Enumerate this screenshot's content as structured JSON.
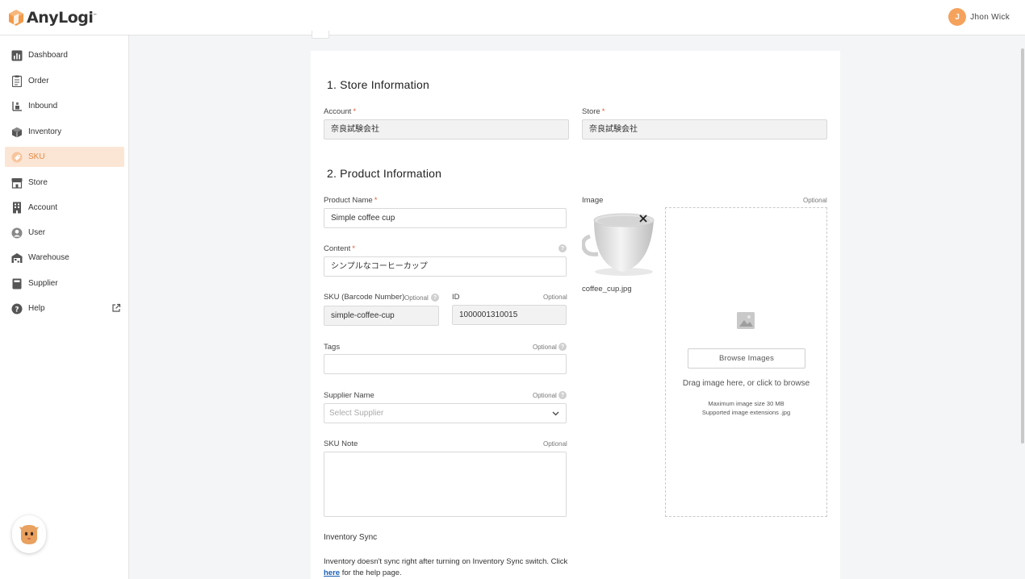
{
  "header": {
    "logo_text": "AnyLogi",
    "logo_tm": "™",
    "user_initial": "J",
    "user_name": "Jhon Wick"
  },
  "sidebar": {
    "items": [
      {
        "label": "Dashboard",
        "icon": "bar-chart-icon"
      },
      {
        "label": "Order",
        "icon": "clipboard-icon"
      },
      {
        "label": "Inbound",
        "icon": "inbound-icon"
      },
      {
        "label": "Inventory",
        "icon": "box-icon"
      },
      {
        "label": "SKU",
        "icon": "tag-icon",
        "active": true
      },
      {
        "label": "Store",
        "icon": "storefront-icon"
      },
      {
        "label": "Account",
        "icon": "building-icon"
      },
      {
        "label": "User",
        "icon": "user-circle-icon"
      },
      {
        "label": "Warehouse",
        "icon": "warehouse-icon"
      },
      {
        "label": "Supplier",
        "icon": "supplier-icon"
      },
      {
        "label": "Help",
        "icon": "question-icon",
        "external": true
      }
    ]
  },
  "form": {
    "section1_title": "1.  Store Information",
    "account_label": "Account",
    "account_value": "奈良試験会社",
    "store_label": "Store",
    "store_value": "奈良試験会社",
    "section2_title": "2.  Product Information",
    "product_name_label": "Product Name",
    "product_name_value": "Simple coffee cup",
    "content_label": "Content",
    "content_value": "シンプルなコーヒーカップ",
    "sku_label": "SKU (Barcode Number)",
    "sku_optional": "Optional",
    "sku_value": "simple-coffee-cup",
    "id_label": "ID",
    "id_optional": "Optional",
    "id_value": "1000001310015",
    "tags_label": "Tags",
    "tags_optional": "Optional",
    "supplier_label": "Supplier Name",
    "supplier_optional": "Optional",
    "supplier_placeholder": "Select Supplier",
    "note_label": "SKU Note",
    "note_optional": "Optional",
    "required_mark": "*",
    "image_label": "Image",
    "image_optional": "Optional",
    "image_filename": "coffee_cup.jpg",
    "browse_button": "Browse Images",
    "drag_text": "Drag image here, or click to browse",
    "max_size_text": "Maximum image size 30 MB",
    "extensions_text": "Supported image extensions .jpg",
    "sync_label": "Inventory Sync",
    "sync_text": "Inventory doesn't sync right after turning on Inventory Sync switch. Click",
    "sync_link": "here",
    "sync_text_after": "for the help page."
  },
  "colors": {
    "accent": "#e8873e",
    "active_bg": "#fbe6d6",
    "required": "#e05c3a",
    "link": "#1a5fb4"
  }
}
